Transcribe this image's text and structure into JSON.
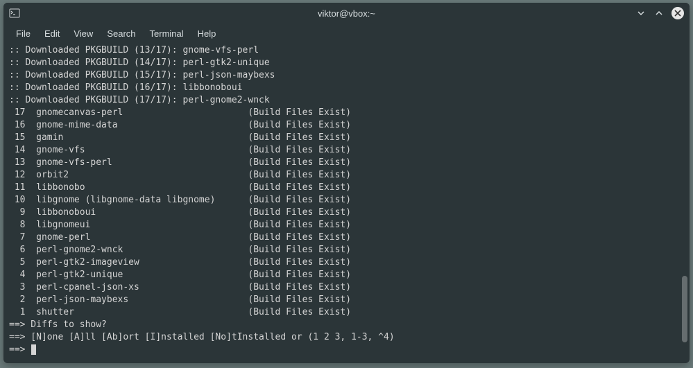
{
  "window": {
    "title": "viktor@vbox:~"
  },
  "menu": {
    "file": "File",
    "edit": "Edit",
    "view": "View",
    "search": "Search",
    "terminal": "Terminal",
    "help": "Help"
  },
  "download_lines": [
    ":: Downloaded PKGBUILD (13/17): gnome-vfs-perl",
    ":: Downloaded PKGBUILD (14/17): perl-gtk2-unique",
    ":: Downloaded PKGBUILD (15/17): perl-json-maybexs",
    ":: Downloaded PKGBUILD (16/17): libbonoboui",
    ":: Downloaded PKGBUILD (17/17): perl-gnome2-wnck"
  ],
  "packages": [
    {
      "idx": " 17",
      "name": "gnomecanvas-perl",
      "pad": "                       ",
      "status": "(Build Files Exist)"
    },
    {
      "idx": " 16",
      "name": "gnome-mime-data",
      "pad": "                        ",
      "status": "(Build Files Exist)"
    },
    {
      "idx": " 15",
      "name": "gamin",
      "pad": "                                  ",
      "status": "(Build Files Exist)"
    },
    {
      "idx": " 14",
      "name": "gnome-vfs",
      "pad": "                              ",
      "status": "(Build Files Exist)"
    },
    {
      "idx": " 13",
      "name": "gnome-vfs-perl",
      "pad": "                         ",
      "status": "(Build Files Exist)"
    },
    {
      "idx": " 12",
      "name": "orbit2",
      "pad": "                                 ",
      "status": "(Build Files Exist)"
    },
    {
      "idx": " 11",
      "name": "libbonobo",
      "pad": "                              ",
      "status": "(Build Files Exist)"
    },
    {
      "idx": " 10",
      "name": "libgnome (libgnome-data libgnome)",
      "pad": "      ",
      "status": "(Build Files Exist)"
    },
    {
      "idx": "  9",
      "name": "libbonoboui",
      "pad": "                            ",
      "status": "(Build Files Exist)"
    },
    {
      "idx": "  8",
      "name": "libgnomeui",
      "pad": "                             ",
      "status": "(Build Files Exist)"
    },
    {
      "idx": "  7",
      "name": "gnome-perl",
      "pad": "                             ",
      "status": "(Build Files Exist)"
    },
    {
      "idx": "  6",
      "name": "perl-gnome2-wnck",
      "pad": "                       ",
      "status": "(Build Files Exist)"
    },
    {
      "idx": "  5",
      "name": "perl-gtk2-imageview",
      "pad": "                    ",
      "status": "(Build Files Exist)"
    },
    {
      "idx": "  4",
      "name": "perl-gtk2-unique",
      "pad": "                       ",
      "status": "(Build Files Exist)"
    },
    {
      "idx": "  3",
      "name": "perl-cpanel-json-xs",
      "pad": "                    ",
      "status": "(Build Files Exist)"
    },
    {
      "idx": "  2",
      "name": "perl-json-maybexs",
      "pad": "                      ",
      "status": "(Build Files Exist)"
    },
    {
      "idx": "  1",
      "name": "shutter",
      "pad": "                                ",
      "status": "(Build Files Exist)"
    }
  ],
  "prompts": {
    "diffs": "==> Diffs to show?",
    "options": "==> [N]one [A]ll [Ab]ort [I]nstalled [No]tInstalled or (1 2 3, 1-3, ^4)",
    "cursor": "==> "
  }
}
